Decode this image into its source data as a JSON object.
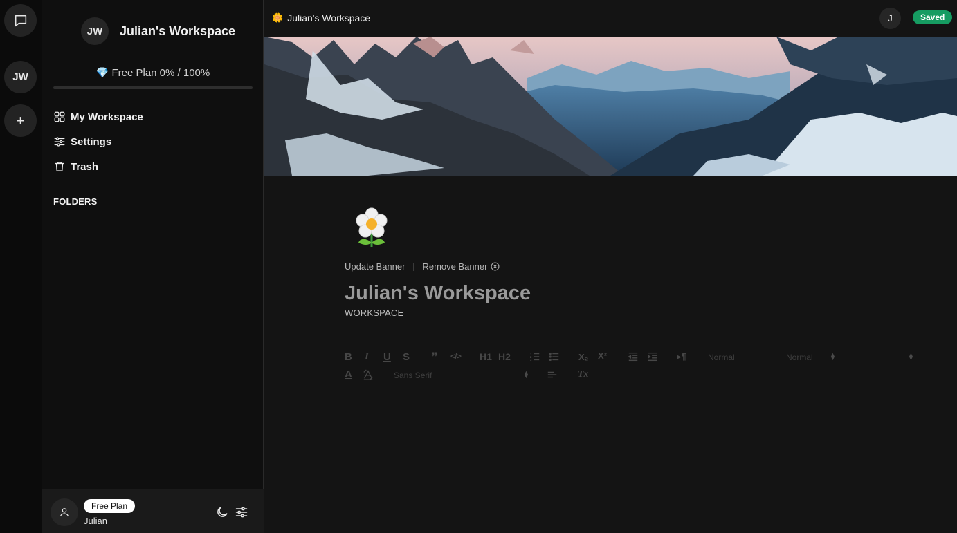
{
  "rail": {
    "workspace_initials": "JW",
    "add_label": "+"
  },
  "sidebar": {
    "workspace_initials": "JW",
    "workspace_name": "Julian's Workspace",
    "plan_text": "Free Plan 0% / 100%",
    "plan_icon": "💎",
    "usage_percent": 0,
    "nav": [
      {
        "label": "My Workspace",
        "icon": "grid-icon"
      },
      {
        "label": "Settings",
        "icon": "sliders-icon"
      },
      {
        "label": "Trash",
        "icon": "trash-icon"
      }
    ],
    "folders_label": "FOLDERS"
  },
  "user": {
    "plan_badge": "Free Plan",
    "name": "Julian"
  },
  "topbar": {
    "emoji": "🌼",
    "breadcrumb": "Julian's Workspace",
    "avatar_initial": "J",
    "status": "Saved"
  },
  "document": {
    "update_banner": "Update Banner",
    "remove_banner": "Remove Banner",
    "title": "Julian's Workspace",
    "subtitle": "WORKSPACE"
  },
  "toolbar": {
    "bold": "B",
    "italic": "I",
    "underline": "U",
    "strike": "S",
    "quote": "❞",
    "code": "</>",
    "h1": "H1",
    "h2": "H2",
    "subscript": "X₂",
    "superscript": "X²",
    "rtl": "▸¶",
    "header_select": "Normal",
    "size_select": "Normal",
    "font_select": "Sans Serif",
    "font_color": "A",
    "clean": "Tx"
  },
  "colors": {
    "saved": "#169c62",
    "background": "#141414",
    "sidebar": "#0f0f0f"
  }
}
